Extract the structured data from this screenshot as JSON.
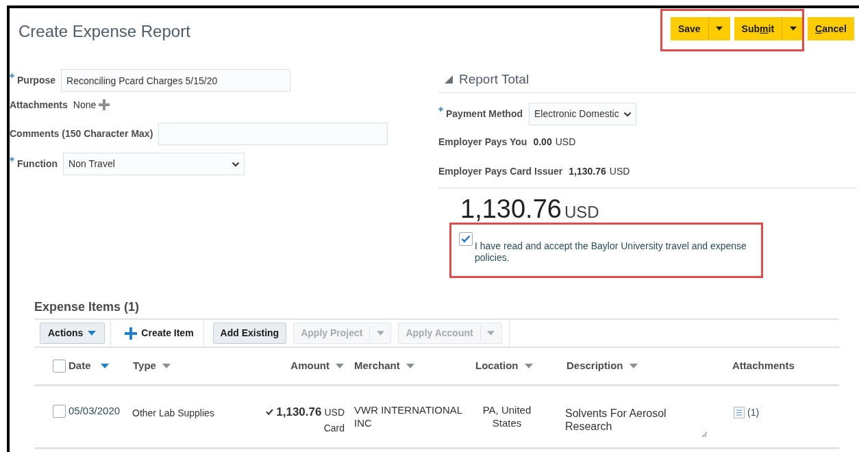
{
  "page": {
    "title": "Create Expense Report"
  },
  "actions": [
    {
      "label": "Save",
      "has_menu": true
    },
    {
      "label_before": "Sub",
      "mnemonic": "m",
      "label_after": "it",
      "has_menu": true
    },
    {
      "mnemonic": "C",
      "label_after": "ancel",
      "has_menu": false
    }
  ],
  "form": {
    "fields": [
      {
        "kind": "text",
        "label": "Purpose",
        "required": true,
        "value": "Reconciling Pcard Charges 5/15/20"
      },
      {
        "kind": "attachments",
        "label": "Attachments",
        "required": false,
        "value": "None"
      },
      {
        "kind": "text",
        "label": "Comments (150 Character Max)",
        "required": false
      },
      {
        "kind": "select",
        "label": "Function",
        "required": true,
        "value": "Non Travel"
      }
    ]
  },
  "report_total": {
    "title": "Report Total",
    "expanded": true,
    "fields": [
      {
        "kind": "select",
        "label": "Payment Method",
        "required": true,
        "value": "Electronic Domestic"
      },
      {
        "kind": "amount",
        "label": "Employer Pays You",
        "required": false,
        "amount": "0.00",
        "currency": "USD"
      },
      {
        "kind": "amount",
        "label": "Employer Pays Card Issuer",
        "required": false,
        "amount": "1,130.76",
        "currency": "USD"
      }
    ],
    "total": "1,130.76",
    "currency": "USD",
    "policy": {
      "checked": true,
      "text": "I have read and accept the Baylor University travel and expense policies."
    }
  },
  "expense_items": {
    "title": "Expense Items (1)",
    "toolbar": [
      {
        "kind": "menu",
        "label": "Actions",
        "disabled": false
      },
      {
        "kind": "create",
        "label": "Create Item",
        "disabled": false
      },
      {
        "kind": "button",
        "label": "Add Existing",
        "disabled": false
      },
      {
        "kind": "split",
        "label": "Apply Project",
        "disabled": true
      },
      {
        "kind": "split",
        "label": "Apply Account",
        "disabled": true
      }
    ],
    "all_selected": false,
    "columns": [
      {
        "label": "Date",
        "sortable": true,
        "sorted": true
      },
      {
        "label": "Type",
        "sortable": true,
        "sorted": false
      },
      {
        "label": "Amount",
        "sortable": true,
        "sorted": false
      },
      {
        "label": "Merchant",
        "sortable": true,
        "sorted": false
      },
      {
        "label": "Location",
        "sortable": true,
        "sorted": false
      },
      {
        "label": "Description",
        "sortable": true,
        "sorted": false
      },
      {
        "label": "Attachments",
        "sortable": false
      }
    ],
    "rows": [
      {
        "selected": false,
        "date": "05/03/2020",
        "type": "Other Lab Supplies",
        "amount": "1,130.76",
        "currency": "USD",
        "payment": "Card",
        "merchant": "VWR INTERNATIONAL INC",
        "location": "PA, United States",
        "description": "Solvents For Aerosol Research",
        "attachments": "(1)"
      }
    ]
  }
}
